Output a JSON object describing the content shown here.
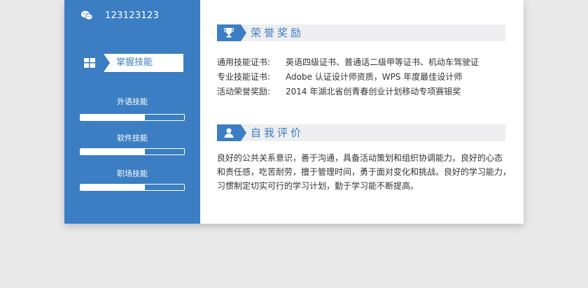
{
  "sidebar": {
    "contact": {
      "wechat": "123123123"
    },
    "skills_header": "掌握技能",
    "skills": [
      {
        "name": "外语技能",
        "level": 0.62
      },
      {
        "name": "软件技能",
        "level": 0.62
      },
      {
        "name": "职场技能",
        "level": 0.62
      }
    ]
  },
  "awards": {
    "title": "荣誉奖励",
    "rows": [
      {
        "key": "通用技能证书:",
        "value": "英语四级证书、普通话二级甲等证书、机动车驾驶证"
      },
      {
        "key": "专业技能证书:",
        "value": "Adobe 认证设计师资质，WPS 年度最佳设计师"
      },
      {
        "key": "活动荣誉奖励:",
        "value": "2014 年湖北省创青春创业计划移动专项赛银奖"
      }
    ]
  },
  "evaluation": {
    "title": "自我评价",
    "lines": [
      "良好的公共关系意识，善于沟通，具备活动策划和组织协调能力。良好的心态",
      "和责任感，吃苦耐劳，擅于管理时间，勇于面对变化和挑战。良好的学习能力，",
      "习惯制定切实可行的学习计划，勤于学习能不断提高。"
    ]
  },
  "colors": {
    "accent": "#3b7ec3",
    "section_bg": "#eeeef0",
    "page_bg": "#e9e9ea"
  },
  "icons": {
    "wechat": "wechat-icon",
    "skills": "windows-icon",
    "awards": "trophy-icon",
    "evaluation": "user-icon"
  }
}
